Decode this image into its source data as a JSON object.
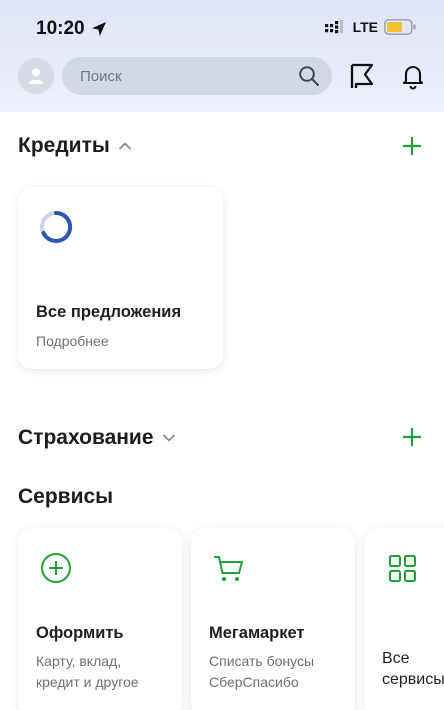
{
  "status": {
    "time": "10:20",
    "network": "LTE"
  },
  "header": {
    "search_placeholder": "Поиск"
  },
  "credits": {
    "title": "Кредиты",
    "card_title": "Все предложения",
    "card_subtitle": "Подробнее"
  },
  "insurance": {
    "title": "Страхование"
  },
  "services": {
    "title": "Сервисы",
    "items": [
      {
        "title": "Оформить",
        "subtitle_line1": "Карту, вклад,",
        "subtitle_line2": "кредит и другое",
        "icon": "plus-circle-icon"
      },
      {
        "title": "Мегамаркет",
        "subtitle_line1": "Списать бонусы",
        "subtitle_line2": "СберСпасибо",
        "icon": "cart-icon"
      },
      {
        "title_line1": "Все",
        "title_line2": "сервисы",
        "icon": "grid-icon"
      }
    ]
  },
  "colors": {
    "accent": "#21a038",
    "spinner": "#2b56b8",
    "battery": "#f2c12e"
  }
}
